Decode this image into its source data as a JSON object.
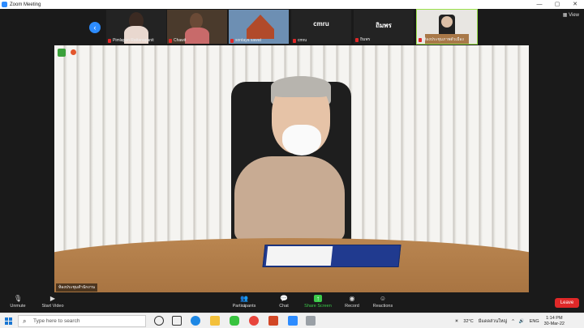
{
  "window": {
    "title": "Zoom Meeting"
  },
  "gallery": {
    "view_label": "View",
    "participants": [
      {
        "name": "Pimlapan Rattanapanit",
        "type": "video"
      },
      {
        "name": "Chawit",
        "type": "video"
      },
      {
        "name": "sontaya sawat",
        "type": "video"
      },
      {
        "name": "cmru",
        "display": "cmru",
        "type": "name"
      },
      {
        "name": "ถิมพร",
        "display": "ถิมพร",
        "type": "name"
      },
      {
        "name": "ห้องประชุมภาพตัวเมือง",
        "type": "video",
        "active": true
      }
    ]
  },
  "main": {
    "speaker_label": "ห้องประชุมสำนักงาน"
  },
  "toolbar": {
    "unmute": "Unmute",
    "start_video": "Start Video",
    "participants": "Participants",
    "participants_count": "11",
    "chat": "Chat",
    "share_screen": "Share Screen",
    "record": "Record",
    "reactions": "Reactions",
    "leave": "Leave"
  },
  "taskbar": {
    "search_placeholder": "Type here to search",
    "weather_temp": "32°C",
    "weather_text": "มีแดดส่วนใหญ่",
    "lang": "ENG",
    "time": "1:14 PM",
    "date": "30-Mar-22"
  },
  "colors": {
    "accent": "#2d8cff",
    "leave": "#e02828",
    "active_outline": "#9be14a"
  }
}
